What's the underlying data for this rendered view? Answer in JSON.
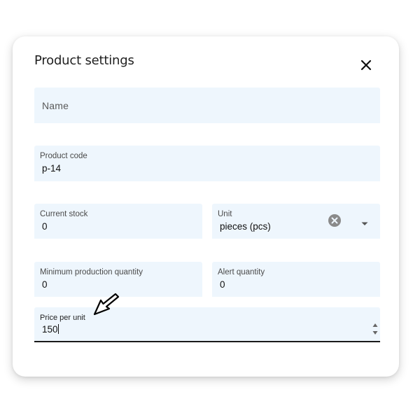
{
  "dialog": {
    "title": "Product settings",
    "close_icon": "close-icon"
  },
  "fields": {
    "name": {
      "placeholder": "Name",
      "value": ""
    },
    "product_code": {
      "label": "Product code",
      "value": "p-14"
    },
    "current_stock": {
      "label": "Current stock",
      "value": "0"
    },
    "unit": {
      "label": "Unit",
      "value": "pieces (pcs)",
      "clear_icon": "clear-icon",
      "dropdown_icon": "chevron-down-icon"
    },
    "min_production_quantity": {
      "label": "Minimum production quantity",
      "value": "0"
    },
    "alert_quantity": {
      "label": "Alert quantity",
      "value": "0"
    },
    "price_per_unit": {
      "label": "Price per unit",
      "value": "150",
      "spinner_icon": "number-spinner-icon"
    }
  },
  "colors": {
    "field_background": "#eef6fd",
    "active_underline": "#1a1a1a",
    "clear_icon": "#8a8a8a"
  },
  "cursor": {
    "icon": "mouse-pointer-icon"
  }
}
